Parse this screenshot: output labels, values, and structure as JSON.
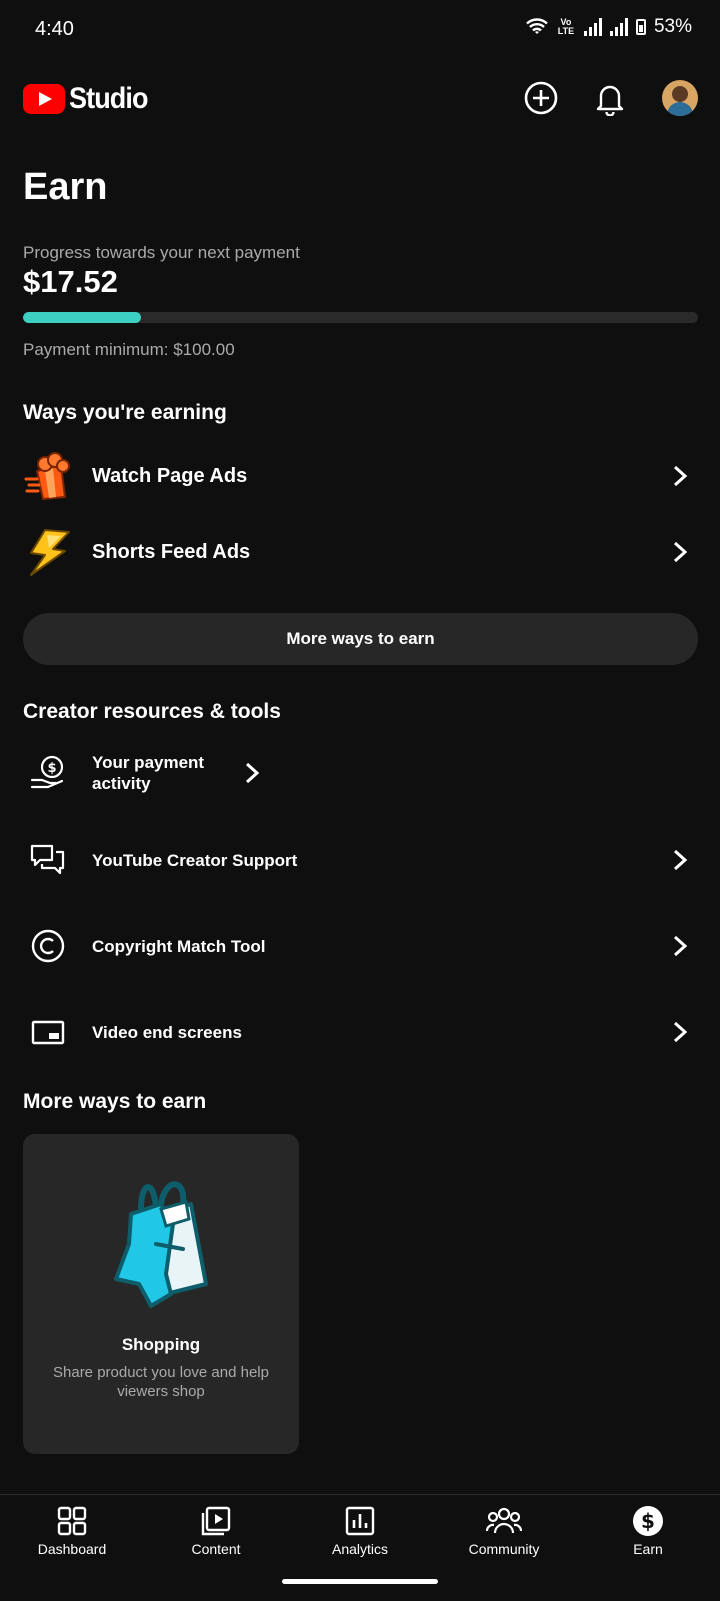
{
  "status_bar": {
    "time": "4:40",
    "volte": "Vo LTE",
    "battery": "53%"
  },
  "header": {
    "app_name": "Studio"
  },
  "page": {
    "title": "Earn"
  },
  "progress": {
    "label": "Progress towards your next payment",
    "amount": "$17.52",
    "fraction": 0.1752,
    "minimum_label": "Payment minimum: $100.00",
    "accent_color": "#3ecfc3"
  },
  "ways_earning": {
    "heading": "Ways you're earning",
    "items": [
      {
        "label": "Watch Page Ads",
        "icon": "popcorn-icon"
      },
      {
        "label": "Shorts Feed Ads",
        "icon": "lightning-icon"
      }
    ],
    "more_button": "More ways to earn"
  },
  "resources": {
    "heading": "Creator resources & tools",
    "items": [
      {
        "label": "Your payment activity",
        "icon": "payment-hand-icon"
      },
      {
        "label": "YouTube Creator Support",
        "icon": "chat-bubbles-icon"
      },
      {
        "label": "Copyright Match Tool",
        "icon": "copyright-icon"
      },
      {
        "label": "Video end screens",
        "icon": "end-screen-icon"
      }
    ]
  },
  "more_ways": {
    "heading": "More ways to earn",
    "card": {
      "title": "Shopping",
      "description": "Share product you love and help viewers shop",
      "icon": "shopping-bag-icon"
    }
  },
  "bottom_nav": {
    "items": [
      {
        "label": "Dashboard",
        "icon": "dashboard-icon"
      },
      {
        "label": "Content",
        "icon": "content-icon"
      },
      {
        "label": "Analytics",
        "icon": "analytics-icon"
      },
      {
        "label": "Community",
        "icon": "community-icon"
      },
      {
        "label": "Earn",
        "icon": "dollar-icon"
      }
    ],
    "active": "Earn"
  }
}
